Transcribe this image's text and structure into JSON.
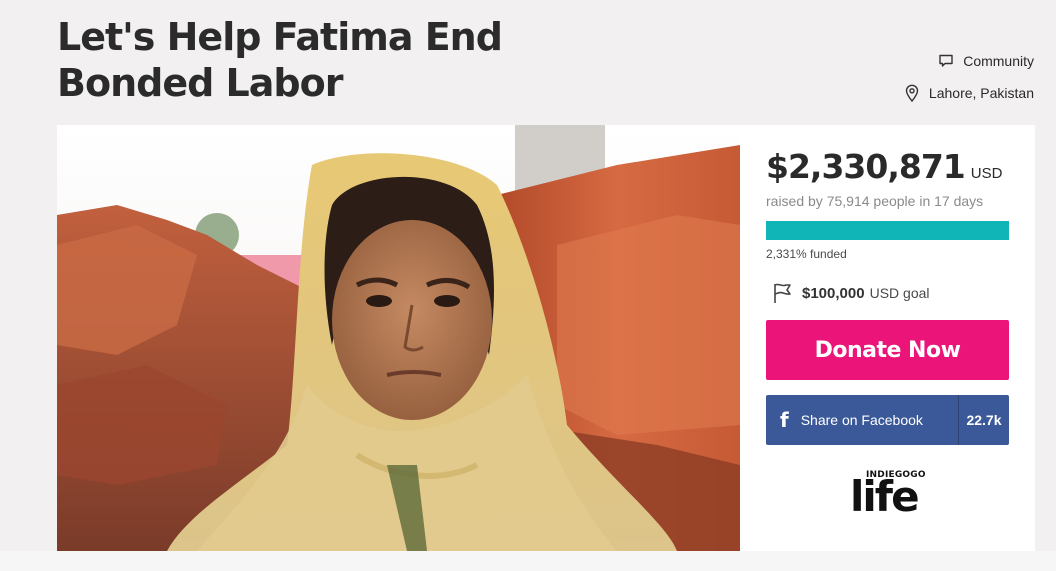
{
  "campaign": {
    "title": "Let's Help Fatima End Bonded Labor",
    "category": "Community",
    "location": "Lahore, Pakistan"
  },
  "funding": {
    "amount": "$2,330,871",
    "currency": "USD",
    "raised_text": "raised by 75,914 people in 17 days",
    "progress_fraction": 1.0,
    "funded_text": "2,331% funded",
    "goal_amount": "$100,000",
    "goal_label": "USD goal"
  },
  "actions": {
    "donate_label": "Donate Now",
    "facebook_label": "Share on Facebook",
    "facebook_count": "22.7k"
  },
  "brand": {
    "top": "INDIEGOGO",
    "word": "life"
  },
  "colors": {
    "progress": "#10b5b7",
    "donate": "#eb1478",
    "facebook": "#3b5998"
  },
  "icons": [
    "speech-bubble-icon",
    "map-pin-icon",
    "flag-icon",
    "facebook-icon"
  ]
}
